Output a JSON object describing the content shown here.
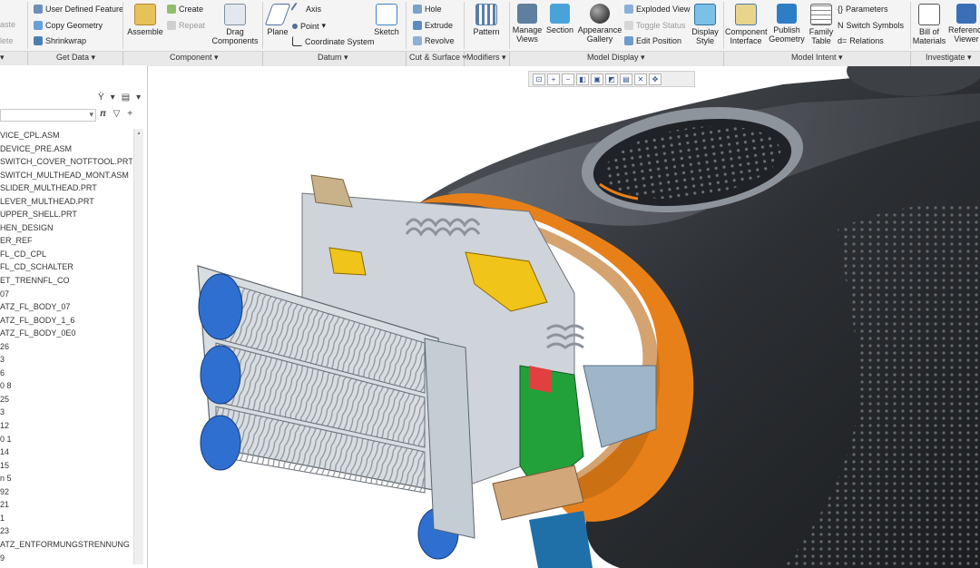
{
  "ribbon": {
    "left_stub": [
      "aste",
      "lete"
    ],
    "get_data": {
      "user_defined_feature": "User Defined Feature",
      "copy_geometry": "Copy Geometry",
      "shrinkwrap": "Shrinkwrap"
    },
    "component": {
      "assemble": "Assemble",
      "create": "Create",
      "repeat": "Repeat",
      "drag_components": "Drag\nComponents"
    },
    "datum": {
      "plane": "Plane",
      "axis": "Axis",
      "point": "Point",
      "coordinate_system": "Coordinate System",
      "sketch": "Sketch"
    },
    "cut_surface": {
      "hole": "Hole",
      "extrude": "Extrude",
      "revolve": "Revolve"
    },
    "modifiers": {
      "pattern": "Pattern"
    },
    "model_display": {
      "manage_views": "Manage\nViews",
      "section": "Section",
      "appearance_gallery": "Appearance\nGallery",
      "exploded_view": "Exploded View",
      "toggle_status": "Toggle Status",
      "edit_position": "Edit Position",
      "display_style": "Display\nStyle"
    },
    "model_intent": {
      "component_interface": "Component\nInterface",
      "publish_geometry": "Publish\nGeometry",
      "family_table": "Family\nTable",
      "parameters": "Parameters",
      "switch_symbols": "Switch Symbols",
      "relations": "Relations"
    },
    "investigate": {
      "bill_of_materials": "Bill of\nMaterials",
      "reference_viewer": "Reference\nViewer"
    }
  },
  "group_bar": {
    "get_data": "Get Data ▾",
    "component": "Component ▾",
    "datum": "Datum ▾",
    "cut_surface": "Cut & Surface ▾",
    "modifiers": "Modifiers ▾",
    "model_display": "Model Display ▾",
    "model_intent": "Model Intent ▾",
    "investigate": "Investigate ▾"
  },
  "tree": {
    "items": [
      "VICE_CPL.ASM",
      "DEVICE_PRE.ASM",
      "SWITCH_COVER_NOTFTOOL.PRT",
      "SWITCH_MULTHEAD_MONT.ASM",
      "SLIDER_MULTHEAD.PRT",
      "LEVER_MULTHEAD.PRT",
      "UPPER_SHELL.PRT",
      "HEN_DESIGN",
      "ER_REF",
      "FL_CD_CPL",
      "FL_CD_SCHALTER",
      "ET_TRENNFL_CO",
      "07",
      "ATZ_FL_BODY_07",
      "ATZ_FL_BODY_1_6",
      "ATZ_FL_BODY_0E0",
      "26",
      "3",
      "6",
      "0 8",
      "25",
      "3",
      "12",
      "0 1",
      "14",
      "15",
      "n 5",
      "92",
      "21",
      "1",
      "23",
      "ATZ_ENTFORMUNGSTRENNUNG",
      "9"
    ]
  },
  "icons": {
    "tree_tools": [
      "tree-tools-icon",
      "settings-icon",
      "dropdown-icon"
    ],
    "search": [
      "search-icon",
      "binoculars-icon",
      "filter-icon",
      "add-icon"
    ],
    "view_toolbar": [
      "refit-icon",
      "zoom-in-icon",
      "zoom-out-icon",
      "repaint-icon",
      "saved-views-icon",
      "display-style-icon",
      "view-manager-icon",
      "datum-display-icon",
      "spin-center-icon"
    ]
  },
  "colors": {
    "ribbon_bg": "#f4f4f4",
    "group_bar_bg": "#e9e9e9",
    "shell": "#2c2f33",
    "orange_rim": "#e8801a",
    "blue": "#2f6fd0",
    "yellow": "#f0c419",
    "green": "#22a13a",
    "steel": "#c7d0d8"
  }
}
